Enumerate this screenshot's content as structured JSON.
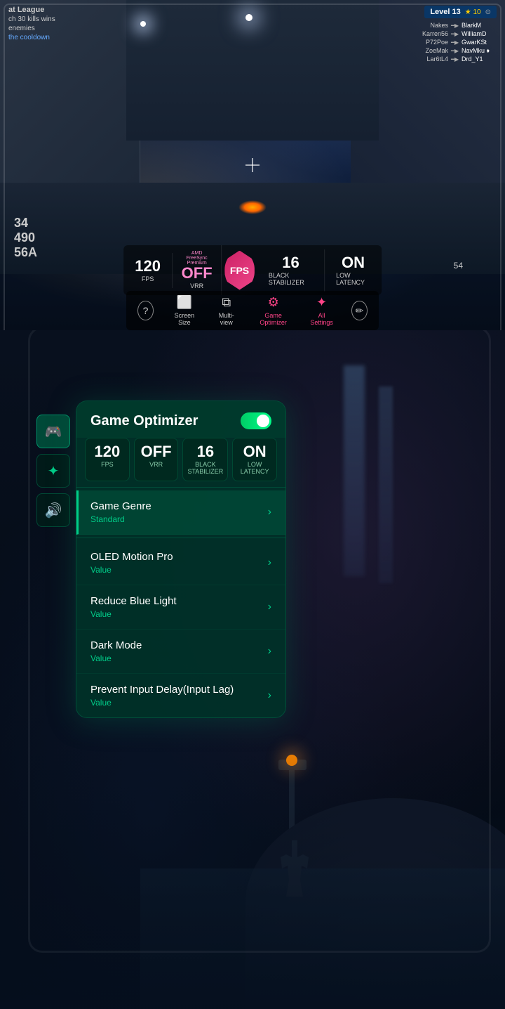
{
  "top": {
    "hud": {
      "league": "at League",
      "kills": "ch 30 kills wins",
      "enemies": "enemies",
      "cooldown": "the cooldown",
      "level": "Level 13",
      "stars": "★ 10",
      "shield_icon": "⊙",
      "players": [
        {
          "left": "Nakes",
          "gun": "🔫",
          "right": "BlarkM"
        },
        {
          "left": "Karren56",
          "gun": "🔫",
          "right": "WilliamD"
        },
        {
          "left": "P72Poe",
          "gun": "🔫",
          "right": "GwarKSt"
        },
        {
          "left": "ZoeMak",
          "gun": "🔫",
          "right": "NavMku ♦"
        },
        {
          "left": "Lar6tL4",
          "gun": "🔫",
          "right": "Drd_Y1"
        }
      ]
    },
    "stats": {
      "fps_value": "120",
      "fps_label": "FPS",
      "vrr_value": "OFF",
      "vrr_label": "VRR",
      "vrr_sublabel": "AMD FreeSync Premium",
      "fps_badge": "FPS",
      "bs_value": "16",
      "bs_label": "Black Stabilizer",
      "latency_value": "ON",
      "latency_label": "Low Latency"
    },
    "menu": {
      "help": "?",
      "screen_size_label": "Screen Size",
      "multiview_label": "Multi-view",
      "optimizer_label": "Game Optimizer",
      "allsettings_label": "All Settings",
      "edit": "✏"
    },
    "score": {
      "a": "34",
      "b": "490",
      "c": "56A"
    },
    "bottom_score": "54"
  },
  "bottom": {
    "panel": {
      "title": "Game Optimizer",
      "toggle_on": true,
      "stats": {
        "fps_value": "120",
        "fps_label": "FPS",
        "vrr_value": "OFF",
        "vrr_label": "VRR",
        "bs_value": "16",
        "bs_label": "Black Stabilizer",
        "latency_value": "ON",
        "latency_label": "Low Latency"
      },
      "menu_items": [
        {
          "title": "Game Genre",
          "value": "Standard",
          "active": true
        },
        {
          "title": "OLED Motion Pro",
          "value": "Value",
          "active": false
        },
        {
          "title": "Reduce Blue Light",
          "value": "Value",
          "active": false
        },
        {
          "title": "Dark Mode",
          "value": "Value",
          "active": false
        },
        {
          "title": "Prevent Input Delay(Input Lag)",
          "value": "Value",
          "active": false
        }
      ]
    },
    "sidebar": {
      "icons": [
        {
          "name": "gamepad",
          "symbol": "🎮",
          "active": true
        },
        {
          "name": "settings",
          "symbol": "✦",
          "active": false
        },
        {
          "name": "sound",
          "symbol": "🔊",
          "active": false
        }
      ]
    }
  },
  "colors": {
    "accent_pink": "#ff4488",
    "accent_green": "#00cc88",
    "accent_blue": "#4488ff",
    "bg_dark": "#050810"
  }
}
